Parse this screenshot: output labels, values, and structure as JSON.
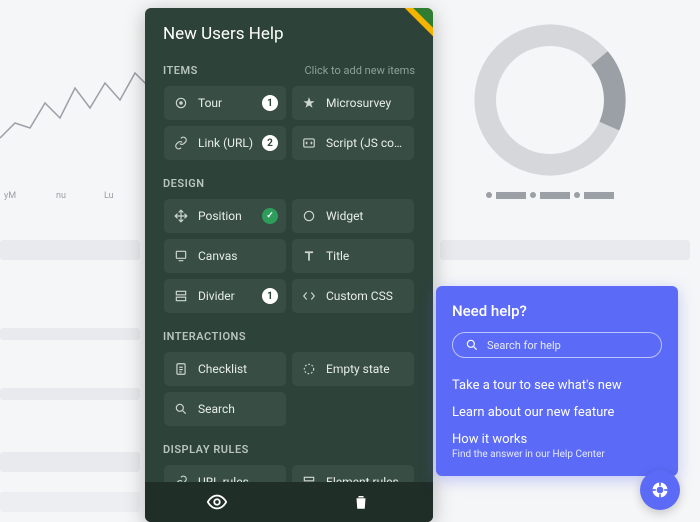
{
  "panel": {
    "title": "New Users Help",
    "sections": {
      "items": {
        "label": "ITEMS",
        "hint": "Click to add new items",
        "rows": [
          {
            "icon": "target",
            "label": "Tour",
            "badge": "1"
          },
          {
            "icon": "star",
            "label": "Microsurvey"
          },
          {
            "icon": "link",
            "label": "Link (URL)",
            "badge": "2"
          },
          {
            "icon": "code",
            "label": "Script (JS code)"
          }
        ]
      },
      "design": {
        "label": "DESIGN",
        "rows": [
          {
            "icon": "move",
            "label": "Position",
            "badge_check": true
          },
          {
            "icon": "widget",
            "label": "Widget"
          },
          {
            "icon": "canvas",
            "label": "Canvas"
          },
          {
            "icon": "title",
            "label": "Title"
          },
          {
            "icon": "divider",
            "label": "Divider",
            "badge": "1"
          },
          {
            "icon": "css",
            "label": "Custom CSS"
          }
        ]
      },
      "interactions": {
        "label": "INTERACTIONS",
        "rows": [
          {
            "icon": "checklist",
            "label": "Checklist"
          },
          {
            "icon": "empty",
            "label": "Empty state"
          },
          {
            "icon": "search",
            "label": "Search"
          }
        ]
      },
      "display_rules": {
        "label": "DISPLAY RULES",
        "rows": [
          {
            "icon": "link",
            "label": "URL rules"
          },
          {
            "icon": "element",
            "label": "Element rules"
          }
        ]
      }
    }
  },
  "help": {
    "title": "Need help?",
    "placeholder": "Search for help",
    "links": [
      {
        "label": "Take a tour to see what's new"
      },
      {
        "label": "Learn about our new feature"
      },
      {
        "label": "How it works",
        "sub": "Find the answer in our Help Center"
      }
    ]
  },
  "bg": {
    "xlabels": [
      "yM",
      "nu",
      "Lu"
    ]
  }
}
